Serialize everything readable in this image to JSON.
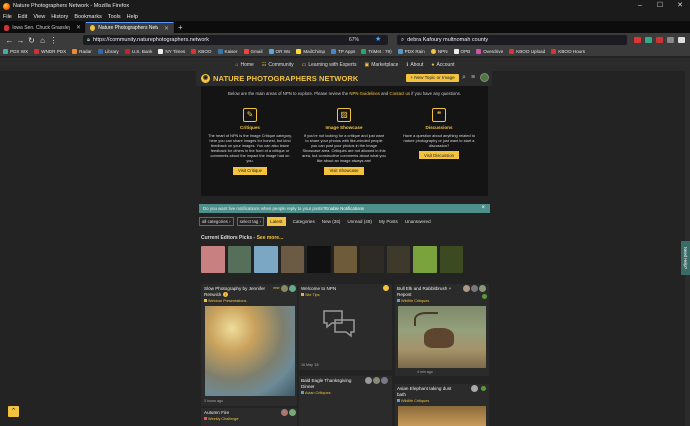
{
  "browser": {
    "window_title": "Nature Photographers Network - Mozilla Firefox",
    "menu": [
      "File",
      "Edit",
      "View",
      "History",
      "Bookmarks",
      "Tools",
      "Help"
    ],
    "tabs": [
      {
        "label": "Iowa Sen. Chuck Grassley, 87, ...",
        "active": false
      },
      {
        "label": "Nature Photographers Network",
        "active": true
      }
    ],
    "url": "https://community.naturephotographers.network",
    "zoom": "67%",
    "search_value": "debra Kafoury multnomah county"
  },
  "bookmarks": [
    "PDX WX",
    "WNDR PDX",
    "Radar",
    "Library",
    "U.S. Bank",
    "NY Times",
    "KBOO",
    "Kaiser",
    "Gmail",
    "OR Wx",
    "MailChimp",
    "TP Apps",
    "TriMet : 79)",
    "PDX Rain",
    "NPN",
    "OPB",
    "Overdrive",
    "KBOO Upload",
    "KBOO Hours"
  ],
  "site": {
    "nav": [
      {
        "icon": "home-icon",
        "glyph": "⌂",
        "label": "Home"
      },
      {
        "icon": "community-icon",
        "glyph": "☷",
        "label": "Community"
      },
      {
        "icon": "learning-icon",
        "glyph": "▭",
        "label": "Learning with Experts"
      },
      {
        "icon": "marketplace-icon",
        "glyph": "▣",
        "label": "Marketplace"
      },
      {
        "icon": "about-icon",
        "glyph": "ℹ",
        "label": "About"
      },
      {
        "icon": "account-icon",
        "glyph": "●",
        "label": "Account"
      }
    ],
    "brand": "NATURE PHOTOGRAPHERS NETWORK",
    "new_topic_label": "+ New Topic or Image",
    "accent": "#f3c340"
  },
  "intro": {
    "before": "Below are the main areas of NPN to explore. Please review the ",
    "link1": "NPN Guidelines",
    "middle": " and ",
    "link2": "Contact us",
    "after": " if you have any questions."
  },
  "columns": [
    {
      "icon": "pencil-icon",
      "glyph": "✎",
      "title": "Critiques",
      "text": "The heart of NPN is the Image Critique category, here you can share images for honest, but kind feedback on your images. You can also leave feedback for others in the form of a critique or comments about the impact the image had on you.",
      "button": "Visit Critique"
    },
    {
      "icon": "image-icon",
      "glyph": "▨",
      "title": "Image Showcase",
      "text": "If you're not looking for a critique and just want to share your photos with like-minded people you can post your photos in the Image Showcase area. Critiques are not allowed in this area, but constructive comments about what you like about an image always are!",
      "button": "Visit Showcase"
    },
    {
      "icon": "chat-icon",
      "glyph": "❝",
      "title": "Discussions",
      "text": "Have a question about anything related to nature photography or just want to start a discussion?",
      "button": "Visit Discussion"
    }
  ],
  "notification": {
    "text": "Do you want live notifications when people reply to your posts? ",
    "link": "Enable Notifications",
    "close": "×"
  },
  "filters": {
    "categories": "all categories ›",
    "tags": "select tag ›",
    "tabs": [
      "Latest",
      "Categories",
      "New (36)",
      "Unread (49)",
      "My Posts",
      "Unanswered"
    ]
  },
  "picks": {
    "label": "Current Editors Picks - ",
    "more": "See more..."
  },
  "thumb_colors": [
    "#c98080",
    "#556f5a",
    "#7ba6c4",
    "#6b5b44",
    "#111111",
    "#6d5b3a",
    "#2e2a24",
    "#3d3a2b",
    "#7aa23d",
    "#3c4a22"
  ],
  "cards": [
    {
      "title": "Slow Photography by Jennifer Renwick",
      "badge": "new",
      "category": "Webinar Presentations",
      "cat_color": "#f3c340",
      "meta": "3 hours ago"
    },
    {
      "title": "Welcome to NPN",
      "category": "Site Tips",
      "cat_color": "#e3b03a",
      "meta": "16 May '18"
    },
    {
      "title": "Bull Elk and Rabbitbrush + Repost",
      "category": "Wildlife Critiques",
      "cat_color": "#5aa0d8",
      "meta": "4 min ago"
    },
    {
      "title": "Bald Eagle Thanksgiving Dinner",
      "category": "Avian Critiques",
      "cat_color": "#5aa0d8",
      "meta": ""
    },
    {
      "title": "Asian Elephant taking dust bath",
      "category": "Wildlife Critiques",
      "cat_color": "#5aa0d8",
      "meta": ""
    },
    {
      "title": "Autumn Fire",
      "category": "Weekly Challenge",
      "cat_color": "#e05c5c",
      "meta": ""
    }
  ],
  "side_help": "Need Help?"
}
